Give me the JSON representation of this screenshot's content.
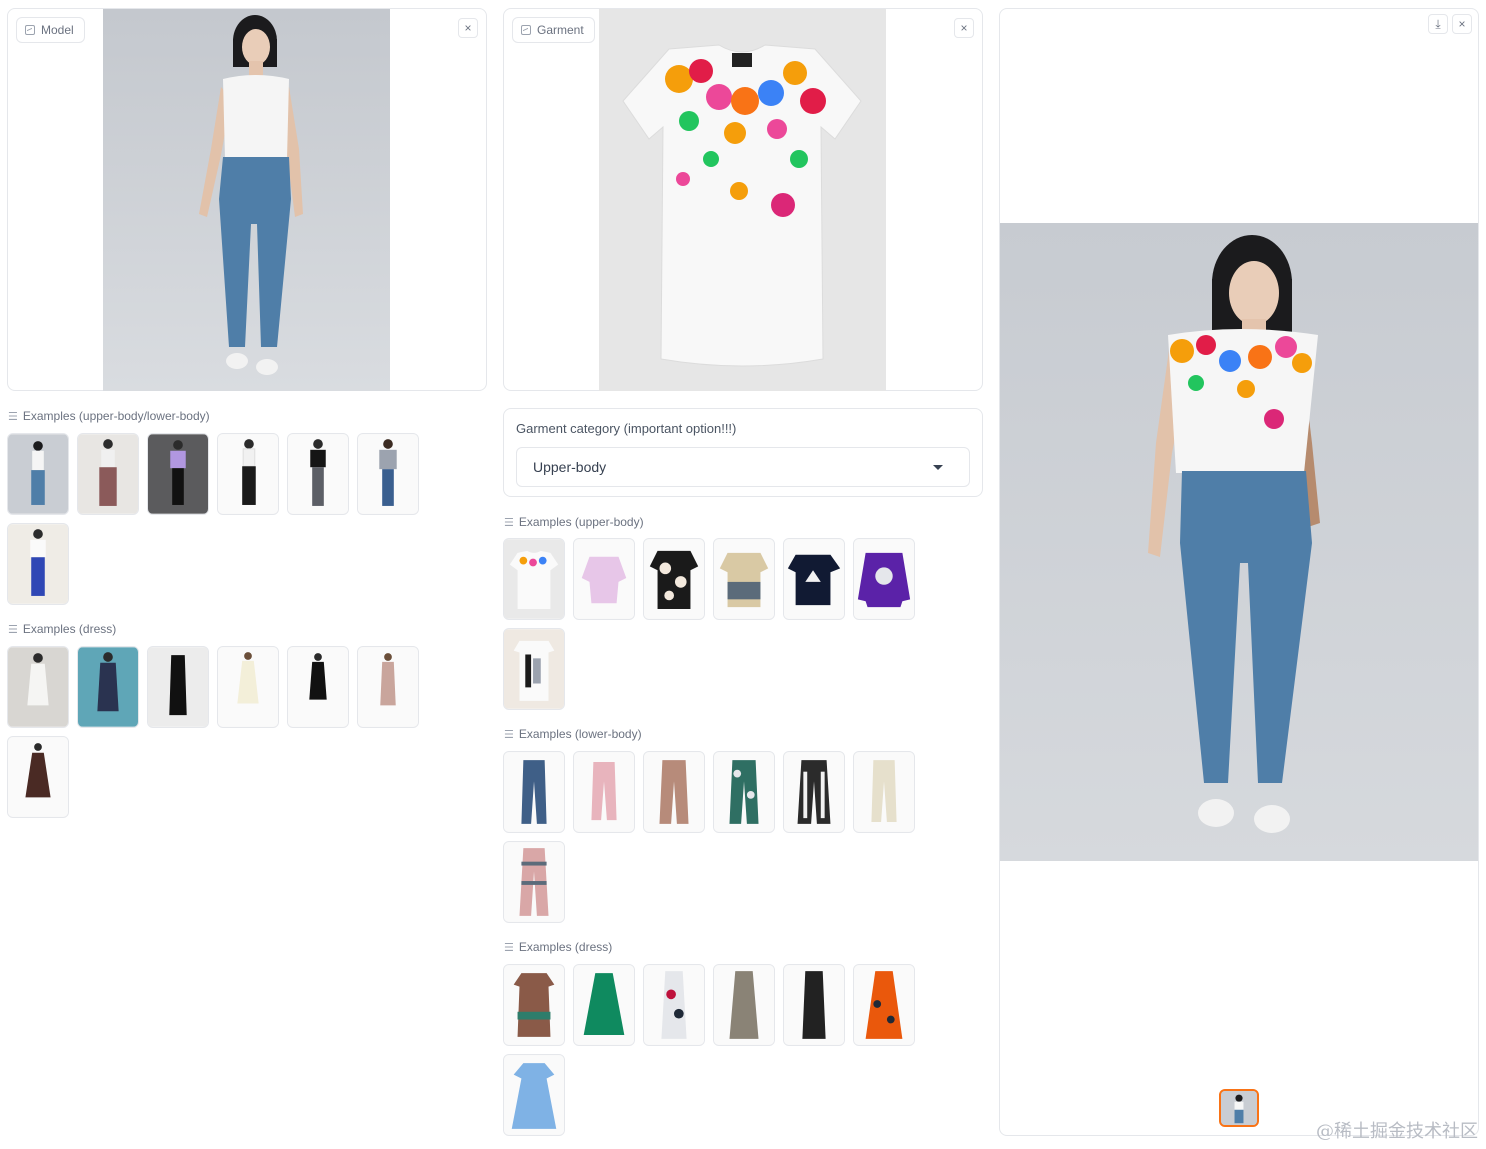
{
  "model_panel": {
    "badge": "Model",
    "clear_label": "×"
  },
  "garment_panel": {
    "badge": "Garment",
    "clear_label": "×"
  },
  "result_panel": {
    "download_label": "⤓",
    "clear_label": "×"
  },
  "model_examples_upper_lower": {
    "label": "Examples (upper-body/lower-body)",
    "count": 7
  },
  "model_examples_dress": {
    "label": "Examples (dress)",
    "count": 7
  },
  "garment_category": {
    "title": "Garment category (important option!!!)",
    "value": "Upper-body"
  },
  "garment_examples_upper": {
    "label": "Examples (upper-body)",
    "count": 7
  },
  "garment_examples_lower": {
    "label": "Examples (lower-body)",
    "count": 7
  },
  "garment_examples_dress": {
    "label": "Examples (dress)",
    "count": 7
  },
  "watermark": "@稀土掘金技术社区",
  "colors": {
    "accent": "#f97316",
    "border": "#e5e7eb",
    "backdrop": "#c9cdd3",
    "denim": "#4a78a8"
  }
}
